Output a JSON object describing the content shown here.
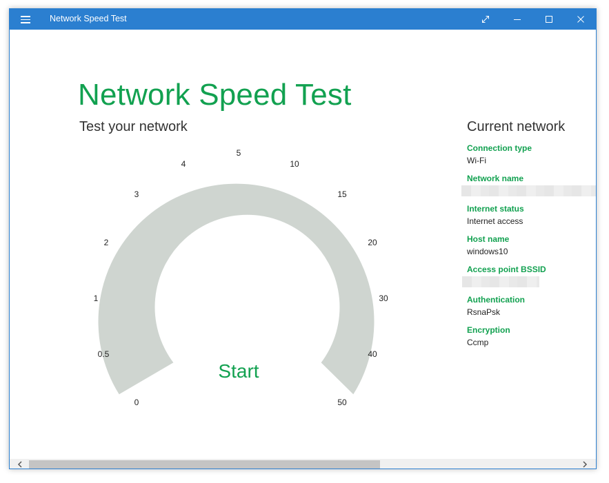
{
  "window": {
    "title": "Network Speed Test"
  },
  "header": {
    "title": "Network Speed Test",
    "subtitle": "Test your network"
  },
  "gauge": {
    "tick_labels": [
      "0",
      "0.5",
      "1",
      "2",
      "3",
      "4",
      "5",
      "10",
      "15",
      "20",
      "30",
      "40",
      "50"
    ],
    "start_label": "Start",
    "arc_color": "#cfd5d0"
  },
  "network": {
    "heading": "Current network",
    "items": [
      {
        "label": "Connection type",
        "value": "Wi-Fi"
      },
      {
        "label": "Network name",
        "value": ""
      },
      {
        "label": "Internet status",
        "value": "Internet access"
      },
      {
        "label": "Host name",
        "value": "windows10"
      },
      {
        "label": "Access point BSSID",
        "value": ""
      },
      {
        "label": "Authentication",
        "value": "RsnaPsk"
      },
      {
        "label": "Encryption",
        "value": "Ccmp"
      }
    ]
  },
  "colors": {
    "accent": "#12a150",
    "titlebar": "#2b7fd0"
  },
  "icons": {
    "menu": "hamburger-menu-icon",
    "fullscreen": "expand-icon",
    "minimize": "minimize-icon",
    "maximize": "maximize-icon",
    "close": "close-icon",
    "scroll_left": "chevron-left-icon",
    "scroll_right": "chevron-right-icon"
  }
}
